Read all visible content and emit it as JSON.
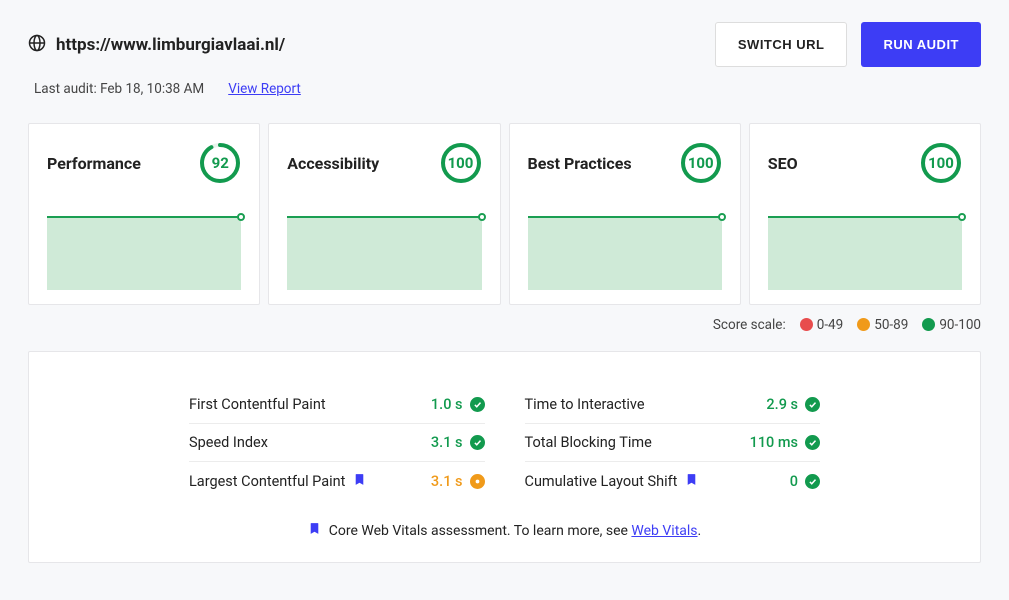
{
  "header": {
    "url": "https://www.limburgiavlaai.nl/",
    "switch_url_label": "SWITCH URL",
    "run_audit_label": "RUN AUDIT"
  },
  "subheader": {
    "last_audit": "Last audit: Feb 18, 10:38 AM",
    "view_report": "View Report"
  },
  "cards": [
    {
      "title": "Performance",
      "score": "92",
      "ring_stroke_dasharray": "104 113",
      "ring_color": "#129a4e"
    },
    {
      "title": "Accessibility",
      "score": "100",
      "ring_stroke_dasharray": "113 113",
      "ring_color": "#129a4e"
    },
    {
      "title": "Best Practices",
      "score": "100",
      "ring_stroke_dasharray": "113 113",
      "ring_color": "#129a4e"
    },
    {
      "title": "SEO",
      "score": "100",
      "ring_stroke_dasharray": "113 113",
      "ring_color": "#129a4e"
    }
  ],
  "scale": {
    "label": "Score scale:",
    "ranges": [
      "0-49",
      "50-89",
      "90-100"
    ]
  },
  "metrics": [
    {
      "name": "First Contentful Paint",
      "value": "1.0 s",
      "status": "good",
      "bookmark": false
    },
    {
      "name": "Time to Interactive",
      "value": "2.9 s",
      "status": "good",
      "bookmark": false
    },
    {
      "name": "Speed Index",
      "value": "3.1 s",
      "status": "good",
      "bookmark": false
    },
    {
      "name": "Total Blocking Time",
      "value": "110 ms",
      "status": "good",
      "bookmark": false
    },
    {
      "name": "Largest Contentful Paint",
      "value": "3.1 s",
      "status": "warn",
      "bookmark": true
    },
    {
      "name": "Cumulative Layout Shift",
      "value": "0",
      "status": "good",
      "bookmark": true
    }
  ],
  "footnote": {
    "text_before": "Core Web Vitals assessment. To learn more, see ",
    "link": "Web Vitals",
    "text_after": "."
  }
}
